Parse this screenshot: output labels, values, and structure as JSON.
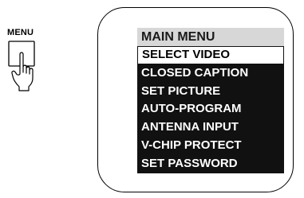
{
  "remote": {
    "menu_button_label": "MENU"
  },
  "tv_menu": {
    "title": "MAIN MENU",
    "items": [
      {
        "label": "SELECT VIDEO",
        "selected": true
      },
      {
        "label": "CLOSED CAPTION",
        "selected": false
      },
      {
        "label": "SET PICTURE",
        "selected": false
      },
      {
        "label": "AUTO-PROGRAM",
        "selected": false
      },
      {
        "label": "ANTENNA INPUT",
        "selected": false
      },
      {
        "label": "V-CHIP PROTECT",
        "selected": false
      },
      {
        "label": "SET PASSWORD",
        "selected": false
      }
    ]
  },
  "colors": {
    "menu_background": "#111111",
    "title_background": "#d7d7d7",
    "highlight_background": "#ffffff"
  },
  "icons": {
    "menu_key": "menu-key-icon",
    "pointing_hand": "pointing-hand-icon"
  }
}
